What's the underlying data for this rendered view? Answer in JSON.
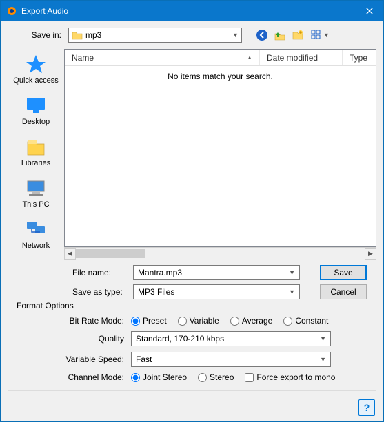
{
  "title": "Export Audio",
  "savein": {
    "label": "Save in:",
    "value": "mp3"
  },
  "filelist": {
    "columns": {
      "name": "Name",
      "date": "Date modified",
      "type": "Type"
    },
    "empty": "No items match your search."
  },
  "places": {
    "quick_access": "Quick access",
    "desktop": "Desktop",
    "libraries": "Libraries",
    "this_pc": "This PC",
    "network": "Network"
  },
  "filename": {
    "label": "File name:",
    "value": "Mantra.mp3"
  },
  "saveastype": {
    "label": "Save as type:",
    "value": "MP3 Files"
  },
  "buttons": {
    "save": "Save",
    "cancel": "Cancel"
  },
  "format": {
    "group": "Format Options",
    "bitrate_label": "Bit Rate Mode:",
    "bitrate_options": {
      "preset": "Preset",
      "variable": "Variable",
      "average": "Average",
      "constant": "Constant"
    },
    "quality_label": "Quality",
    "quality_value": "Standard, 170-210 kbps",
    "varspeed_label": "Variable Speed:",
    "varspeed_value": "Fast",
    "channel_label": "Channel Mode:",
    "channel_options": {
      "joint": "Joint Stereo",
      "stereo": "Stereo"
    },
    "force_mono": "Force export to mono"
  },
  "help": "?"
}
